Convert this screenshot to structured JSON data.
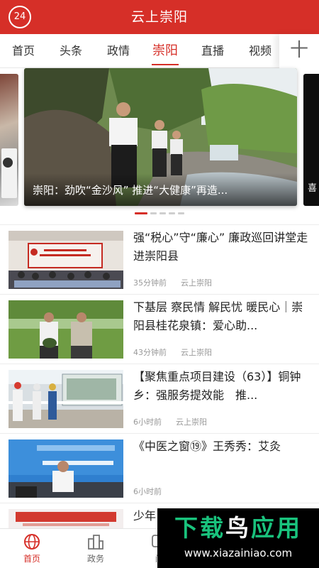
{
  "header": {
    "logo_text": "24",
    "title": "云上崇阳",
    "background_color": "#d62f28"
  },
  "nav": {
    "tabs": [
      {
        "label": "首页",
        "active": false
      },
      {
        "label": "头条",
        "active": false
      },
      {
        "label": "政情",
        "active": false
      },
      {
        "label": "崇阳",
        "active": true
      },
      {
        "label": "直播",
        "active": false
      },
      {
        "label": "视频",
        "active": false
      }
    ],
    "more_icon": "plus-icon",
    "more_label": "十",
    "accent_color": "#d62f28"
  },
  "carousel": {
    "caption": "崇阳：劲吹“金沙风” 推进“大健康”再造...",
    "slide_count": 5,
    "active_index": 0
  },
  "news": [
    {
      "headline": "强“税心”守“廉心” 廉政巡回讲堂走进崇阳县",
      "time": "35分钟前",
      "source": "云上崇阳",
      "thumb": "meeting-hall-image"
    },
    {
      "headline": "下基层 察民情 解民忧 暖民心｜崇阳县桂花泉镇：爱心助...",
      "time": "43分钟前",
      "source": "云上崇阳",
      "thumb": "farmers-field-image"
    },
    {
      "headline": "【聚焦重点项目建设（63）】铜钟乡：强服务提效能　推...",
      "time": "6小时前",
      "source": "云上崇阳",
      "thumb": "construction-site-image"
    },
    {
      "headline": "《中医之窗⑲》王秀秀：艾灸",
      "time": "6小时前",
      "source": "",
      "thumb": "radio-studio-image"
    },
    {
      "headline": "少年",
      "time": "",
      "source": "",
      "thumb": "banner-image"
    }
  ],
  "bottom_bar": {
    "items": [
      {
        "label": "首页",
        "icon": "globe-icon",
        "active": true
      },
      {
        "label": "政务",
        "icon": "buildings-icon",
        "active": false
      },
      {
        "label": "问",
        "icon": "question-icon",
        "active": false
      }
    ]
  },
  "watermark": {
    "title_part1": "下载",
    "title_part2": "鸟",
    "title_part3": "应用",
    "url": "www.xiazainiao.com"
  }
}
